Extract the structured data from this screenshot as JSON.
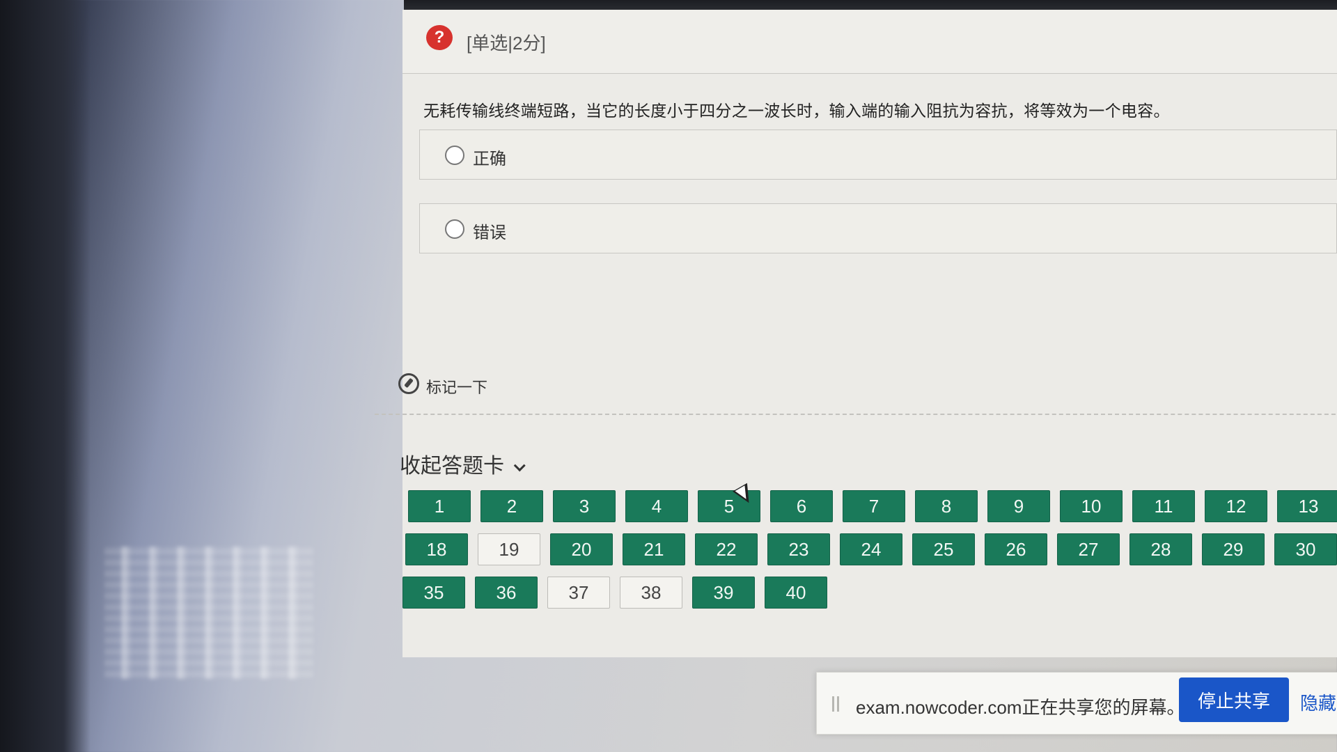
{
  "question": {
    "type_label": "[单选|2分]",
    "icon": "question-icon",
    "icon_glyph": "?",
    "text": "无耗传输线终端短路，当它的长度小于四分之一波长时，输入端的输入阻抗为容抗，将等效为一个电容。",
    "options": [
      {
        "label": "正确",
        "selected": false
      },
      {
        "label": "错误",
        "selected": false
      }
    ]
  },
  "mark": {
    "label": "标记一下",
    "icon": "pin-icon"
  },
  "answer_card": {
    "toggle_label": "收起答题卡",
    "toggle_icon": "chevron-down-icon",
    "rows": [
      [
        {
          "n": "1",
          "s": "answered"
        },
        {
          "n": "2",
          "s": "answered"
        },
        {
          "n": "3",
          "s": "answered"
        },
        {
          "n": "4",
          "s": "answered"
        },
        {
          "n": "5",
          "s": "answered"
        },
        {
          "n": "6",
          "s": "answered"
        },
        {
          "n": "7",
          "s": "answered"
        },
        {
          "n": "8",
          "s": "answered"
        },
        {
          "n": "9",
          "s": "answered"
        },
        {
          "n": "10",
          "s": "answered"
        },
        {
          "n": "11",
          "s": "answered"
        },
        {
          "n": "12",
          "s": "answered"
        },
        {
          "n": "13",
          "s": "answered"
        }
      ],
      [
        {
          "n": "18",
          "s": "answered"
        },
        {
          "n": "19",
          "s": "unanswered"
        },
        {
          "n": "20",
          "s": "answered"
        },
        {
          "n": "21",
          "s": "answered"
        },
        {
          "n": "22",
          "s": "answered"
        },
        {
          "n": "23",
          "s": "answered"
        },
        {
          "n": "24",
          "s": "answered"
        },
        {
          "n": "25",
          "s": "answered"
        },
        {
          "n": "26",
          "s": "answered"
        },
        {
          "n": "27",
          "s": "answered"
        },
        {
          "n": "28",
          "s": "answered"
        },
        {
          "n": "29",
          "s": "answered"
        },
        {
          "n": "30",
          "s": "answered"
        }
      ],
      [
        {
          "n": "35",
          "s": "answered"
        },
        {
          "n": "36",
          "s": "answered"
        },
        {
          "n": "37",
          "s": "unanswered"
        },
        {
          "n": "38",
          "s": "unanswered"
        },
        {
          "n": "39",
          "s": "answered"
        },
        {
          "n": "40",
          "s": "answered"
        }
      ]
    ]
  },
  "share_bar": {
    "message": "exam.nowcoder.com正在共享您的屏幕。",
    "stop_label": "停止共享",
    "hide_label": "隐藏"
  },
  "colors": {
    "answered": "#1a7a5a",
    "question_icon": "#d7322e",
    "stop_button": "#1a56c8"
  }
}
